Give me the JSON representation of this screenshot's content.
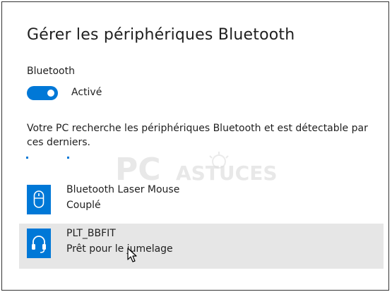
{
  "title": "Gérer les périphériques Bluetooth",
  "bluetooth": {
    "label": "Bluetooth",
    "toggle_on": true,
    "toggle_label": "Activé"
  },
  "description": "Votre PC recherche les périphériques Bluetooth et est détectable par ces derniers.",
  "devices": [
    {
      "name": "Bluetooth Laser Mouse",
      "status": "Couplé",
      "icon": "mouse-icon",
      "selected": false
    },
    {
      "name": "PLT_BBFIT",
      "status": "Prêt pour le jumelage",
      "icon": "headset-icon",
      "selected": true
    }
  ],
  "watermark": {
    "text_main": "PC",
    "text_secondary": "ASTUCES"
  },
  "colors": {
    "accent": "#0078d7",
    "selected_row": "#e6e6e6",
    "text": "#1f1f1f"
  }
}
